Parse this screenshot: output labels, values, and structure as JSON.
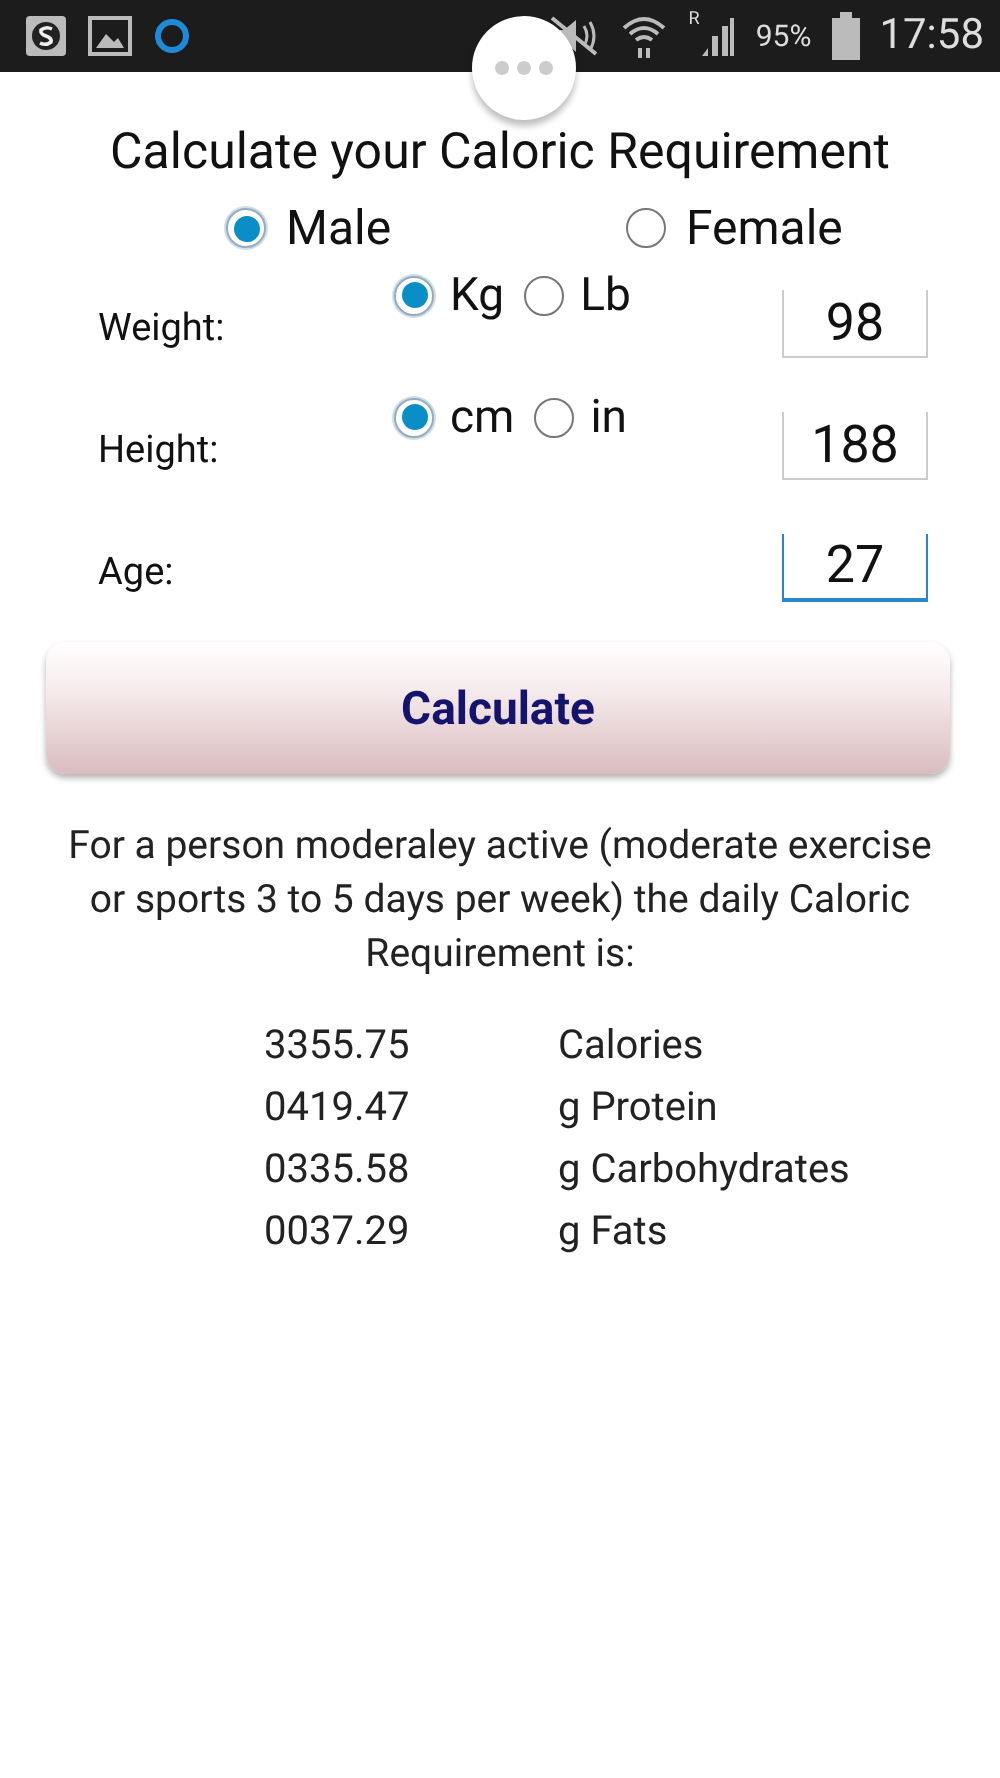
{
  "status_bar": {
    "roaming": "R",
    "battery": "95%",
    "time": "17:58"
  },
  "title": "Calculate your Caloric Requirement",
  "gender": [
    {
      "label": "Male",
      "selected": true
    },
    {
      "label": "Female",
      "selected": false
    }
  ],
  "fields": [
    {
      "label": "Weight:",
      "units": [
        {
          "label": "Kg",
          "selected": true
        },
        {
          "label": "Lb",
          "selected": false
        }
      ],
      "value": "98",
      "focused": false
    },
    {
      "label": "Height:",
      "units": [
        {
          "label": "cm",
          "selected": true
        },
        {
          "label": "in",
          "selected": false
        }
      ],
      "value": "188",
      "focused": false
    },
    {
      "label": "Age:",
      "value": "27",
      "focused": true
    }
  ],
  "button": "Calculate",
  "description": "For a person moderaley active (moderate exercise or sports 3 to 5 days per week) the daily Caloric Requirement is:",
  "results": [
    {
      "value": "3355.75",
      "unit": "Calories"
    },
    {
      "value": "0419.47",
      "unit": "g Protein"
    },
    {
      "value": "0335.58",
      "unit": "g Carbohydrates"
    },
    {
      "value": "0037.29",
      "unit": "g Fats"
    }
  ]
}
